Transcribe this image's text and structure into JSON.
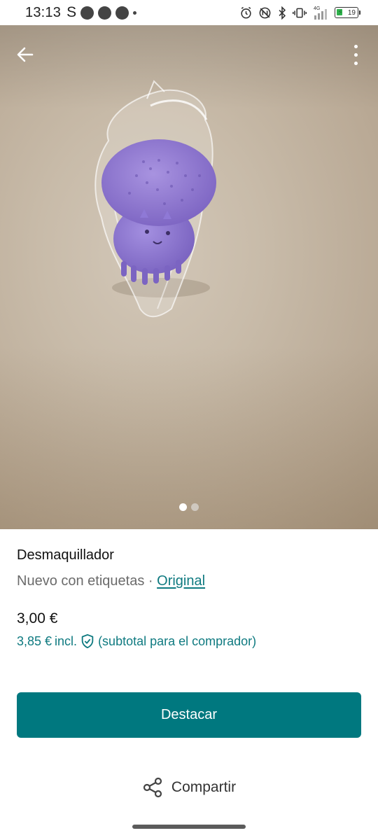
{
  "status_bar": {
    "time": "13:13",
    "carrier_letter": "S",
    "network": "4G",
    "battery_level": "19"
  },
  "photo": {
    "page_count": 2,
    "active_page": 1,
    "active_dot_color": "#ffffff",
    "inactive_dot_color": "#cfc8bf"
  },
  "listing": {
    "title": "Desmaquillador",
    "condition": "Nuevo con etiquetas",
    "separator": "·",
    "brand_link": "Original",
    "price": "3,00 €",
    "buyer_price": "3,85 €",
    "buyer_price_incl": "incl.",
    "buyer_price_note": "(subtotal para el comprador)"
  },
  "actions": {
    "primary_button": "Destacar",
    "share_label": "Compartir"
  },
  "icons": {
    "back": "arrow-left-icon",
    "menu": "more-vertical-icon",
    "shield": "shield-check-icon",
    "share": "share-icon"
  },
  "colors": {
    "accent": "#00787f",
    "link": "#0f7a80",
    "muted_text": "#6b6b6b"
  }
}
